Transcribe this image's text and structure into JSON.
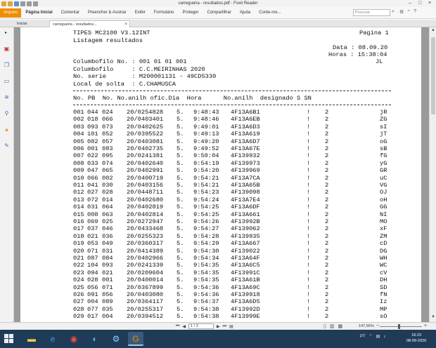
{
  "window": {
    "title": "carregueira - resultados.pdf - Foxit Reader"
  },
  "menu": {
    "file": "Arquivo",
    "items": [
      "Página Inicial",
      "Comentar",
      "Preencher & Assinar",
      "Exibir",
      "Formulário",
      "Proteger",
      "Compartilhar",
      "Ajuda",
      "Conte-me..."
    ],
    "search_placeholder": "Procurar"
  },
  "tabs": {
    "start": "Iniciar",
    "doc": "carregueira - resultados..."
  },
  "report": {
    "header_left1": "TIPES MC2100 V3.12INT",
    "header_left2": "Listagem resultados",
    "page_label": "Pagina 1",
    "date_line": "Data : 08.09.20",
    "time_line": "Horas : 15:38:04",
    "jl": "JL",
    "info1": "Columbofilo No. : 001 01 01 001",
    "info2": "Columbofilo     : C.C.MEIRINHAS 2020",
    "info3": "No. serie       : M200001131 - 49CD5330",
    "info4": "Local de solta  : C.CHAMUSCA",
    "col_header": "No. PB  No. No.anilh ofic.Dia  Hora      No.anilh  designado S SN",
    "rows": [
      [
        "001",
        "044",
        "024",
        "20/0254828",
        "5.",
        "9:48:43",
        "4F13A6B1",
        "!",
        "2",
        "jR"
      ],
      [
        "002",
        "018",
        "066",
        "20/0403401",
        "5.",
        "9:48:46",
        "4F13A6EB",
        "!",
        "2",
        "ZG"
      ],
      [
        "003",
        "093",
        "073",
        "20/0402625",
        "5.",
        "9:49:01",
        "4F13A6D3",
        "!",
        "2",
        "sI"
      ],
      [
        "004",
        "101",
        "052",
        "20/0395522",
        "5.",
        "9:49:13",
        "4F13A619",
        "!",
        "2",
        "jT"
      ],
      [
        "005",
        "082",
        "057",
        "20/0403081",
        "5.",
        "9:49:20",
        "4F13A6D7",
        "!",
        "2",
        "oG"
      ],
      [
        "006",
        "001",
        "083",
        "20/0402735",
        "5.",
        "9:49:52",
        "4F13A67E",
        "!",
        "2",
        "sB"
      ],
      [
        "007",
        "022",
        "095",
        "20/0241381",
        "5.",
        "9:50:04",
        "4F139932",
        "!",
        "2",
        "fG"
      ],
      [
        "008",
        "033",
        "074",
        "20/0402640",
        "5.",
        "9:54:19",
        "4F139973",
        "!",
        "2",
        "yG"
      ],
      [
        "009",
        "047",
        "065",
        "20/0402991",
        "5.",
        "9:54:20",
        "4F139969",
        "!",
        "2",
        "GR"
      ],
      [
        "010",
        "066",
        "002",
        "20/0400719",
        "5.",
        "9:54:21",
        "4F13A7CA",
        "!",
        "2",
        "uC"
      ],
      [
        "011",
        "041",
        "030",
        "20/0403156",
        "5.",
        "9:54:21",
        "4F13A65B",
        "!",
        "2",
        "VG"
      ],
      [
        "012",
        "027",
        "028",
        "20/0448711",
        "5.",
        "9:54:23",
        "4F139098",
        "!",
        "2",
        "OJ"
      ],
      [
        "013",
        "072",
        "014",
        "20/0402680",
        "5.",
        "9:54:24",
        "4F13A7E4",
        "!",
        "2",
        "oH"
      ],
      [
        "014",
        "031",
        "064",
        "20/0402819",
        "5.",
        "9:54:25",
        "4F13A6DF",
        "!",
        "2",
        "GG"
      ],
      [
        "015",
        "008",
        "063",
        "20/0402814",
        "5.",
        "9:54:25",
        "4F13A661",
        "!",
        "2",
        "NI"
      ],
      [
        "016",
        "069",
        "025",
        "20/0272947",
        "5.",
        "9:54:26",
        "4F13992B",
        "!",
        "2",
        "MO"
      ],
      [
        "017",
        "037",
        "046",
        "20/0433468",
        "5.",
        "9:54:27",
        "4F139062",
        "!",
        "2",
        "xF"
      ],
      [
        "018",
        "021",
        "036",
        "20/0255323",
        "5.",
        "9:54:28",
        "4F139935",
        "!",
        "2",
        "ZM"
      ],
      [
        "019",
        "053",
        "049",
        "20/0360317",
        "5.",
        "9:54:29",
        "4F13A667",
        "!",
        "2",
        "cD"
      ],
      [
        "020",
        "071",
        "031",
        "20/0414389",
        "5.",
        "9:54:30",
        "4F139022",
        "!",
        "2",
        "DG"
      ],
      [
        "021",
        "087",
        "084",
        "20/0402966",
        "5.",
        "9:54:34",
        "4F13A64F",
        "!",
        "2",
        "WH"
      ],
      [
        "022",
        "104",
        "093",
        "20/0241339",
        "5.",
        "9:54:35",
        "4F13A6C5",
        "!",
        "2",
        "WC"
      ],
      [
        "023",
        "094",
        "021",
        "20/0209604",
        "5.",
        "9:54:35",
        "4F13991C",
        "!",
        "2",
        "cV"
      ],
      [
        "024",
        "028",
        "001",
        "20/0400014",
        "5.",
        "9:54:35",
        "4F13A61B",
        "!",
        "2",
        "DH"
      ],
      [
        "025",
        "056",
        "071",
        "20/0367899",
        "5.",
        "9:54:36",
        "4F13A69C",
        "!",
        "2",
        "SD"
      ],
      [
        "026",
        "091",
        "056",
        "20/0403080",
        "5.",
        "9:54:36",
        "4F139918",
        "!",
        "2",
        "fN"
      ],
      [
        "027",
        "004",
        "089",
        "20/0364117",
        "5.",
        "9:54:37",
        "4F13A6D5",
        "!",
        "2",
        "Iz"
      ],
      [
        "028",
        "077",
        "035",
        "20/0255317",
        "5.",
        "9:54:38",
        "4F13992D",
        "!",
        "2",
        "MP"
      ],
      [
        "029",
        "017",
        "004",
        "20/0394512",
        "5.",
        "9:54:38",
        "4F13999E",
        "!",
        "2",
        "sO"
      ]
    ]
  },
  "status": {
    "page_indicator": "1 / 3",
    "zoom": "147,55%"
  },
  "taskbar": {
    "tray_lang": "PT",
    "time": "16:23",
    "date": "08-09-2020"
  },
  "colors": {
    "file_button": "#f08c00",
    "taskbar": "#1f3b57"
  }
}
